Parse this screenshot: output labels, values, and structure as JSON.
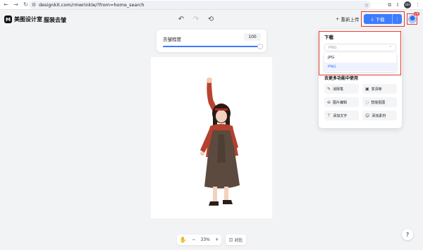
{
  "browser": {
    "url": "designkit.com/rmwrinkle/?from=home_search",
    "profile_initials": "GH"
  },
  "app": {
    "brand_name": "美图设计室",
    "page_title": "服装去皱",
    "reupload_label": "重新上传",
    "download_label": "下载",
    "vip_badge": "VIP"
  },
  "slider": {
    "label": "去皱程度",
    "value": "100",
    "fill_fraction": 1.0
  },
  "download_menu": {
    "title": "下载",
    "selected_format": "PNG",
    "format_options": [
      "JPG",
      "PNG"
    ],
    "highlighted_option": "PNG",
    "more_title": "去更多功能中使用",
    "tools": [
      {
        "label": "消除笔",
        "icon": "pen-icon"
      },
      {
        "label": "变清晰",
        "icon": "sharpen-icon"
      },
      {
        "label": "图片编辑",
        "icon": "edit-icon"
      },
      {
        "label": "智能抠图",
        "icon": "cutout-icon"
      },
      {
        "label": "添加文字",
        "icon": "text-icon"
      },
      {
        "label": "添加素材",
        "icon": "sticker-icon"
      }
    ]
  },
  "bottom_toolbar": {
    "zoom": "33%",
    "compare_label": "对比"
  },
  "help": "?",
  "colors": {
    "accent": "#3d7bff",
    "annotation": "#e53935"
  }
}
